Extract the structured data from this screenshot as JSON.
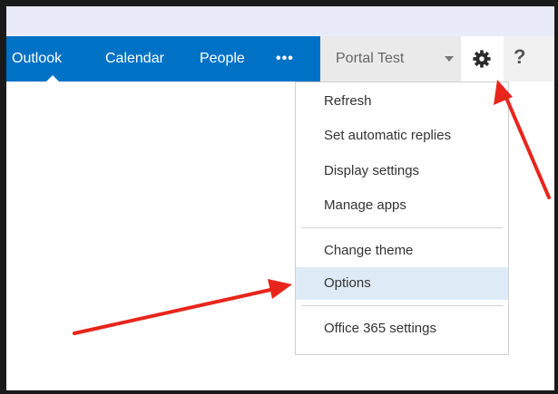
{
  "nav": {
    "items": [
      "Outlook",
      "Calendar",
      "People"
    ],
    "more_label": "•••"
  },
  "user": {
    "name": "Portal Test"
  },
  "help": {
    "label": "?"
  },
  "settings_menu": {
    "group1": [
      "Refresh",
      "Set automatic replies",
      "Display settings",
      "Manage apps"
    ],
    "group2": [
      "Change theme",
      "Options"
    ],
    "group3": [
      "Office 365 settings"
    ],
    "highlighted": "Options"
  },
  "colors": {
    "nav_bar": "#0072c6",
    "highlight": "#deebf7",
    "annotation_arrow": "#e8251c"
  },
  "icons": {
    "settings": "gear-icon",
    "user_dropdown": "chevron-down-icon",
    "help": "question-mark-icon"
  }
}
